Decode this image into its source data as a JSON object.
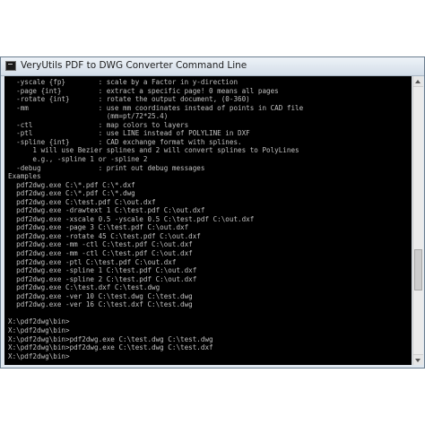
{
  "window": {
    "title": "VeryUtils PDF to DWG Converter Command Line"
  },
  "console": {
    "lines": [
      "  -yscale {fp}        : scale by a Factor in y-direction",
      "  -page {int}         : extract a specific page! 0 means all pages",
      "  -rotate {int}       : rotate the output document, (0-360)",
      "  -mm                 : use mm coordinates instead of points in CAD file",
      "                        (mm=pt/72*25.4)",
      "  -ctl                : map colors to layers",
      "  -ptl                : use LINE instead of POLYLINE in DXF",
      "  -spline {int}       : CAD exchange format with splines.",
      "      1 will use Bezier splines and 2 will convert splines to PolyLines",
      "      e.g., -spline 1 or -spline 2",
      "  -debug              : print out debug messages",
      "Examples",
      "  pdf2dwg.exe C:\\*.pdf C:\\*.dxf",
      "  pdf2dwg.exe C:\\*.pdf C:\\*.dwg",
      "  pdf2dwg.exe C:\\test.pdf C:\\out.dxf",
      "  pdf2dwg.exe -drawtext 1 C:\\test.pdf C:\\out.dxf",
      "  pdf2dwg.exe -xscale 0.5 -yscale 0.5 C:\\test.pdf C:\\out.dxf",
      "  pdf2dwg.exe -page 3 C:\\test.pdf C:\\out.dxf",
      "  pdf2dwg.exe -rotate 45 C:\\test.pdf C:\\out.dxf",
      "  pdf2dwg.exe -mm -ctl C:\\test.pdf C:\\out.dxf",
      "  pdf2dwg.exe -mm -ctl C:\\test.pdf C:\\out.dxf",
      "  pdf2dwg.exe -ptl C:\\test.pdf C:\\out.dxf",
      "  pdf2dwg.exe -spline 1 C:\\test.pdf C:\\out.dxf",
      "  pdf2dwg.exe -spline 2 C:\\test.pdf C:\\out.dxf",
      "  pdf2dwg.exe C:\\test.dxf C:\\test.dwg",
      "  pdf2dwg.exe -ver 10 C:\\test.dwg C:\\test.dwg",
      "  pdf2dwg.exe -ver 16 C:\\test.dxf C:\\test.dwg",
      "",
      "X:\\pdf2dwg\\bin>",
      "X:\\pdf2dwg\\bin>",
      "X:\\pdf2dwg\\bin>pdf2dwg.exe C:\\test.dwg C:\\test.dwg",
      "X:\\pdf2dwg\\bin>pdf2dwg.exe C:\\test.dwg C:\\test.dxf",
      "X:\\pdf2dwg\\bin>"
    ]
  },
  "scrollbar": {
    "position_fraction": 0.72
  }
}
